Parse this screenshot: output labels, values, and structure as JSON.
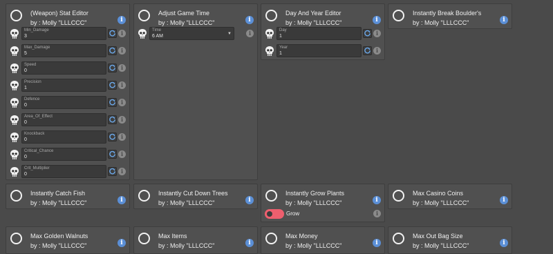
{
  "cards": [
    {
      "title": "(Weapon) Stat Editor",
      "author": "by : Molly \"LLLCCC\"",
      "fields": [
        {
          "label": "Min_Damage",
          "value": "3"
        },
        {
          "label": "Max_Damage",
          "value": "5"
        },
        {
          "label": "Speed",
          "value": "0"
        },
        {
          "label": "Precision",
          "value": "1"
        },
        {
          "label": "Defence",
          "value": "0"
        },
        {
          "label": "Area_Of_Effect",
          "value": "0"
        },
        {
          "label": "Knockback",
          "value": "0"
        },
        {
          "label": "Critical_Chance",
          "value": "0"
        },
        {
          "label": "Crit_Multiplier",
          "value": "0"
        }
      ]
    },
    {
      "title": "Adjust Game Time",
      "author": "by : Molly \"LLLCCC\"",
      "fields": [
        {
          "label": "Time",
          "value": "6 AM",
          "type": "select"
        }
      ]
    },
    {
      "title": "Day And Year Editor",
      "author": "by : Molly \"LLLCCC\"",
      "fields": [
        {
          "label": "Day",
          "value": "1"
        },
        {
          "label": "Year",
          "value": "1"
        }
      ]
    },
    {
      "title": "Instantly Break Boulder's",
      "author": "by : Molly \"LLLCCC\""
    },
    {
      "title": "Instantly Catch Fish",
      "author": "by : Molly \"LLLCCC\""
    },
    {
      "title": "Instantly Cut Down Trees",
      "author": "by : Molly \"LLLCCC\""
    },
    {
      "title": "Instantly Grow Plants",
      "author": "by : Molly \"LLLCCC\"",
      "toggle_label": "Grow"
    },
    {
      "title": "Max Casino Coins",
      "author": "by : Molly \"LLLCCC\""
    },
    {
      "title": "Max Golden Walnuts",
      "author": "by : Molly \"LLLCCC\""
    },
    {
      "title": "Max Items",
      "author": "by : Molly \"LLLCCC\""
    },
    {
      "title": "Max Money",
      "author": "by : Molly \"LLLCCC\""
    },
    {
      "title": "Max Out Bag Size",
      "author": "by : Molly \"LLLCCC\""
    }
  ],
  "icons": {
    "info": "i",
    "caret": "▼",
    "info_color": "#5b8fd6",
    "toggle_on_color": "#ee5f6e",
    "reset_color": "#6aa8ea"
  }
}
